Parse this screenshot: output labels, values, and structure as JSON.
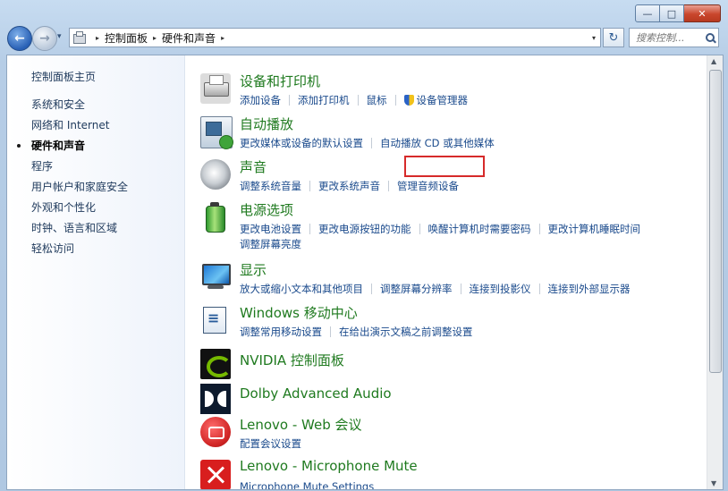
{
  "window": {
    "minimize_glyph": "—",
    "maximize_glyph": "□",
    "close_glyph": "✕"
  },
  "nav": {
    "back_glyph": "←",
    "forward_glyph": "→",
    "history_glyph": "▾",
    "breadcrumb": [
      "控制面板",
      "硬件和声音"
    ],
    "separator_glyph": "▸",
    "address_dropdown_glyph": "▾",
    "refresh_glyph": "↻",
    "search_placeholder": "搜索控制..."
  },
  "sidebar": {
    "home": "控制面板主页",
    "items": [
      {
        "label": "系统和安全"
      },
      {
        "label": "网络和 Internet"
      },
      {
        "label": "硬件和声音",
        "current": true
      },
      {
        "label": "程序"
      },
      {
        "label": "用户帐户和家庭安全"
      },
      {
        "label": "外观和个性化"
      },
      {
        "label": "时钟、语言和区域"
      },
      {
        "label": "轻松访问"
      }
    ]
  },
  "categories": [
    {
      "id": "devices",
      "title": "设备和打印机",
      "icon": "printer-icon",
      "links": [
        "添加设备",
        "添加打印机",
        "鼠标",
        "设备管理器"
      ]
    },
    {
      "id": "autoplay",
      "title": "自动播放",
      "icon": "autoplay-icon",
      "links": [
        "更改媒体或设备的默认设置",
        "自动播放 CD 或其他媒体"
      ]
    },
    {
      "id": "sound",
      "title": "声音",
      "icon": "speaker-icon",
      "links": [
        "调整系统音量",
        "更改系统声音",
        "管理音频设备"
      ]
    },
    {
      "id": "power",
      "title": "电源选项",
      "icon": "battery-icon",
      "links": [
        "更改电池设置",
        "更改电源按钮的功能",
        "唤醒计算机时需要密码",
        "更改计算机睡眠时间",
        "调整屏幕亮度"
      ]
    },
    {
      "id": "display",
      "title": "显示",
      "icon": "monitor-icon",
      "links": [
        "放大或缩小文本和其他项目",
        "调整屏幕分辨率",
        "连接到投影仪",
        "连接到外部显示器"
      ]
    },
    {
      "id": "mobility",
      "title": "Windows 移动中心",
      "icon": "mobility-center-icon",
      "links": [
        "调整常用移动设置",
        "在给出演示文稿之前调整设置"
      ]
    },
    {
      "id": "nvidia",
      "title": "NVIDIA 控制面板",
      "icon": "nvidia-icon",
      "links": []
    },
    {
      "id": "dolby",
      "title": "Dolby Advanced Audio",
      "icon": "dolby-icon",
      "links": []
    },
    {
      "id": "lenovo-web",
      "title": "Lenovo - Web 会议",
      "icon": "webcam-icon",
      "links": [
        "配置会议设置"
      ]
    },
    {
      "id": "lenovo-mic",
      "title": "Lenovo - Microphone Mute",
      "icon": "mic-mute-icon",
      "links": [
        "Microphone Mute Settings"
      ]
    }
  ],
  "scrollbar": {
    "up_glyph": "▲",
    "down_glyph": "▼"
  }
}
